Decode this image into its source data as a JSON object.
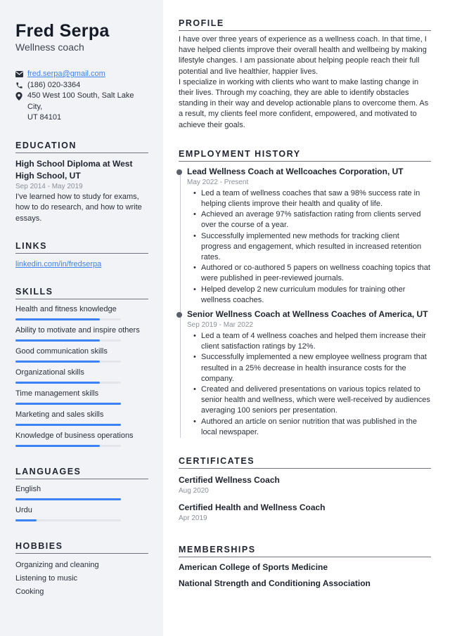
{
  "header": {
    "name": "Fred Serpa",
    "title": "Wellness coach"
  },
  "contact": {
    "email": "fred.serpa@gmail.com",
    "phone": "(186) 020-3364",
    "address_line1": "450 West 100 South, Salt Lake City,",
    "address_line2": "UT 84101",
    "icons": [
      "envelope-icon",
      "phone-icon",
      "map-pin-icon"
    ]
  },
  "education": {
    "heading": "EDUCATION",
    "items": [
      {
        "title": "High School Diploma at West High School, UT",
        "dates": "Sep 2014 - May 2019",
        "description": "I've learned how to study for exams, how to do research, and how to write essays."
      }
    ]
  },
  "links": {
    "heading": "LINKS",
    "items": [
      {
        "label": "linkedin.com/in/fredserpa"
      }
    ]
  },
  "skills": {
    "heading": "SKILLS",
    "items": [
      {
        "label": "Health and fitness knowledge",
        "level": 0.8
      },
      {
        "label": "Ability to motivate and inspire others",
        "level": 0.8
      },
      {
        "label": "Good communication skills",
        "level": 0.8
      },
      {
        "label": "Organizational skills",
        "level": 0.8
      },
      {
        "label": "Time management skills",
        "level": 1.0
      },
      {
        "label": "Marketing and sales skills",
        "level": 1.0
      },
      {
        "label": "Knowledge of business operations",
        "level": 0.8
      }
    ]
  },
  "languages": {
    "heading": "LANGUAGES",
    "items": [
      {
        "label": "English",
        "level": 1.0
      },
      {
        "label": "Urdu",
        "level": 0.2
      }
    ]
  },
  "hobbies": {
    "heading": "HOBBIES",
    "items": [
      "Organizing and cleaning",
      "Listening to music",
      "Cooking"
    ]
  },
  "profile": {
    "heading": "PROFILE",
    "paragraphs": [
      "I have over three years of experience as a wellness coach. In that time, I have helped clients improve their overall health and wellbeing by making lifestyle changes. I am passionate about helping people reach their full potential and live healthier, happier lives.",
      "I specialize in working with clients who want to make lasting change in their lives. Through my coaching, they are able to identify obstacles standing in their way and develop actionable plans to overcome them. As a result, my clients feel more confident, empowered, and motivated to achieve their goals."
    ]
  },
  "employment": {
    "heading": "EMPLOYMENT HISTORY",
    "jobs": [
      {
        "title": "Lead Wellness Coach at Wellcoaches Corporation, UT",
        "dates": "May 2022 - Present",
        "bullets": [
          "Led a team of wellness coaches that saw a 98% success rate in helping clients improve their health and quality of life.",
          "Achieved an average 97% satisfaction rating from clients served over the course of a year.",
          "Successfully implemented new methods for tracking client progress and engagement, which resulted in increased retention rates.",
          "Authored or co-authored 5 papers on wellness coaching topics that were published in peer-reviewed journals.",
          "Helped develop 2 new curriculum modules for training other wellness coaches."
        ]
      },
      {
        "title": "Senior Wellness Coach at Wellness Coaches of America, UT",
        "dates": "Sep 2019 - Mar 2022",
        "bullets": [
          "Led a team of 4 wellness coaches and helped them increase their client satisfaction ratings by 12%.",
          "Successfully implemented a new employee wellness program that resulted in a 25% decrease in health insurance costs for the company.",
          "Created and delivered presentations on various topics related to senior health and wellness, which were well-received by audiences averaging 100 seniors per presentation.",
          "Authored an article on senior nutrition that was published in the local newspaper."
        ]
      }
    ]
  },
  "certificates": {
    "heading": "CERTIFICATES",
    "items": [
      {
        "title": "Certified Wellness Coach",
        "date": "Aug 2020"
      },
      {
        "title": "Certified Health and Wellness Coach",
        "date": "Apr 2019"
      }
    ]
  },
  "memberships": {
    "heading": "MEMBERSHIPS",
    "items": [
      "American College of Sports Medicine",
      "National Strength and Conditioning Association"
    ]
  },
  "colors": {
    "accent": "#3b82f6",
    "sidebar_bg": "#f2f3f6",
    "text": "#1f2430",
    "muted": "#8a8f99"
  }
}
